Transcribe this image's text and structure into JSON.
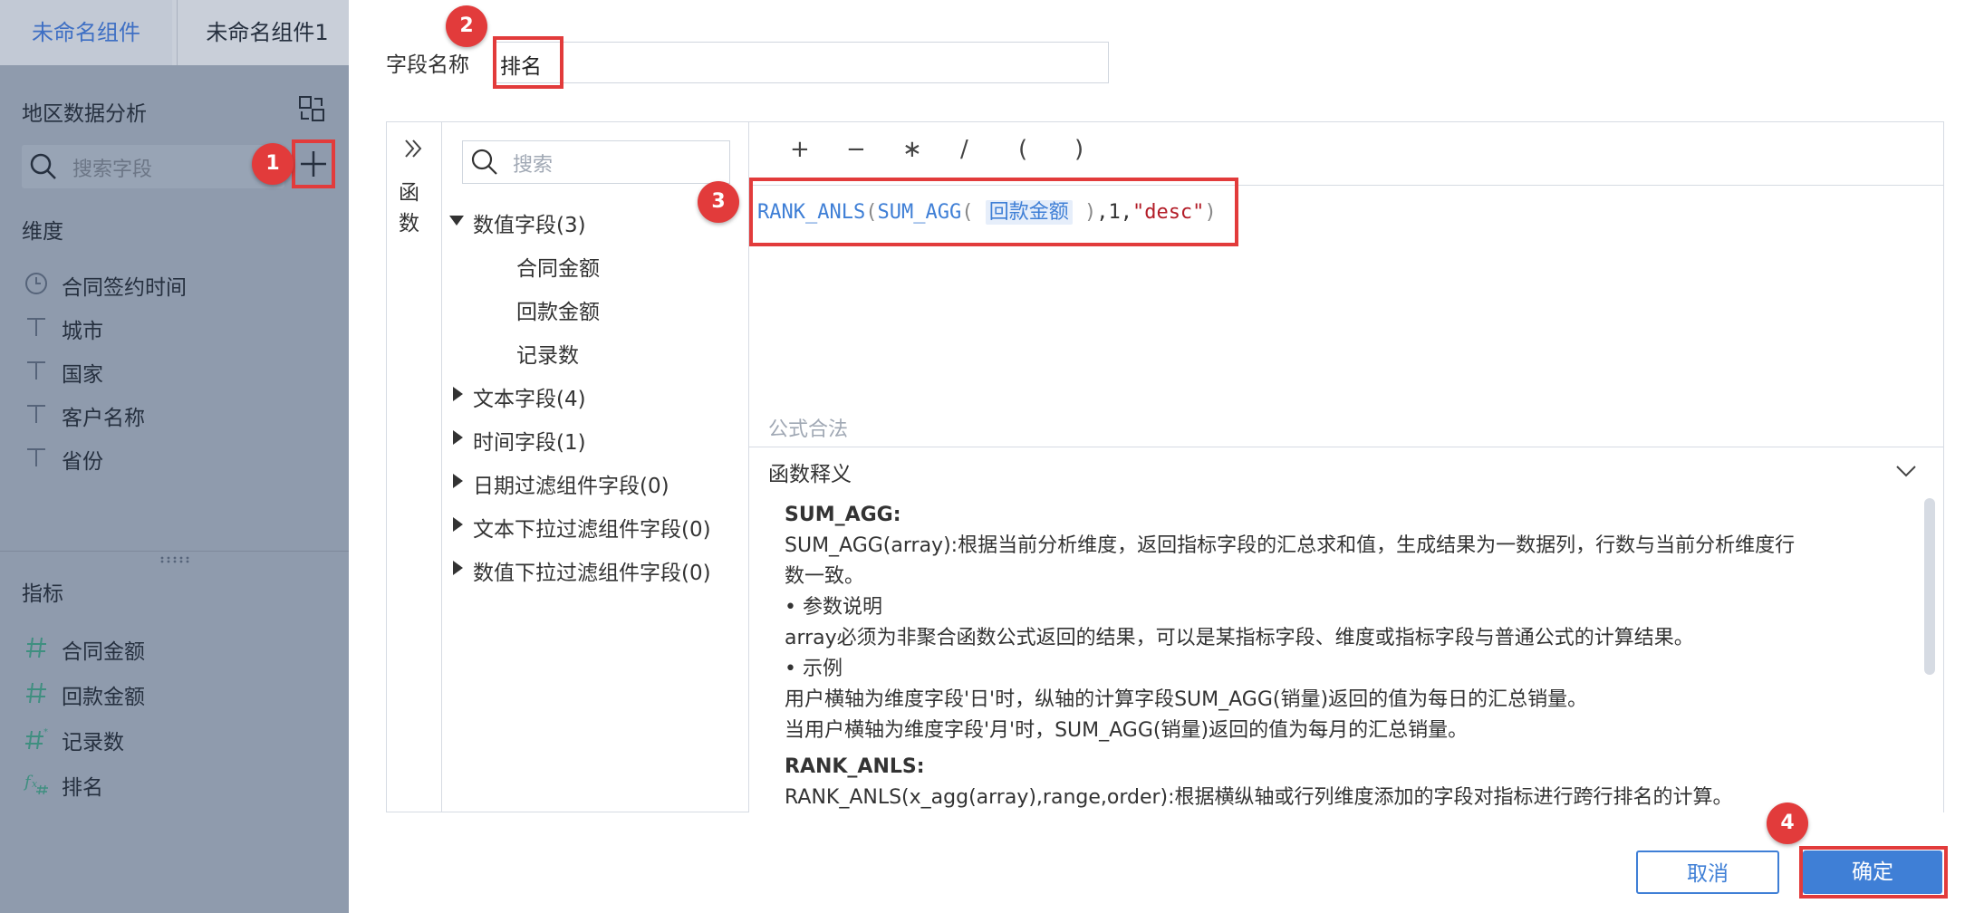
{
  "tabs": [
    "未命名组件",
    "未命名组件1"
  ],
  "left_panel": {
    "dataset_title": "地区数据分析",
    "search_placeholder": "搜索字段",
    "dimension_title": "维度",
    "dimensions": [
      {
        "label": "合同签约时间",
        "icon": "clock-icon"
      },
      {
        "label": "城市",
        "icon": "text-type-icon"
      },
      {
        "label": "国家",
        "icon": "text-type-icon"
      },
      {
        "label": "客户名称",
        "icon": "text-type-icon"
      },
      {
        "label": "省份",
        "icon": "text-type-icon"
      }
    ],
    "metric_title": "指标",
    "metrics": [
      {
        "label": "合同金额",
        "icon": "number-type-icon"
      },
      {
        "label": "回款金额",
        "icon": "number-type-icon"
      },
      {
        "label": "记录数",
        "icon": "count-type-icon"
      },
      {
        "label": "排名",
        "icon": "formula-type-icon"
      }
    ]
  },
  "badges": [
    "1",
    "2",
    "3",
    "4"
  ],
  "dialog": {
    "field_name_label": "字段名称",
    "field_name_value": "排名",
    "function_toggle_label": "函数",
    "field_search_placeholder": "搜索",
    "tree": [
      {
        "label": "数值字段(3)",
        "expanded": true,
        "children": [
          "合同金额",
          "回款金额",
          "记录数"
        ]
      },
      {
        "label": "文本字段(4)",
        "expanded": false
      },
      {
        "label": "时间字段(1)",
        "expanded": false
      },
      {
        "label": "日期过滤组件字段(0)",
        "expanded": false
      },
      {
        "label": "文本下拉过滤组件字段(0)",
        "expanded": false
      },
      {
        "label": "数值下拉过滤组件字段(0)",
        "expanded": false
      }
    ],
    "operators": [
      "+",
      "−",
      "∗",
      "/",
      "(",
      ")"
    ],
    "formula": {
      "fn1": "RANK_ANLS",
      "open1": "(",
      "fn2": "SUM_AGG",
      "open2": "(",
      "field": "回款金额",
      "close2": ")",
      "comma1": ",",
      "num": "1",
      "comma2": ",",
      "str": "\"desc\"",
      "close1": ")"
    },
    "validation_message": "公式合法",
    "explanation_title": "函数释义",
    "explanation": {
      "sum_title": "SUM_AGG:",
      "sum_desc1": "SUM_AGG(array):根据当前分析维度，返回指标字段的汇总求和值，生成结果为一数据列，行数与当前分析维度行",
      "sum_desc2": "数一致。",
      "param_title": "• 参数说明",
      "param_desc": "array必须为非聚合函数公式返回的结果，可以是某指标字段、维度或指标字段与普通公式的计算结果。",
      "example_title": "• 示例",
      "example1": "用户横轴为维度字段'日'时，纵轴的计算字段SUM_AGG(销量)返回的值为每日的汇总销量。",
      "example2": "当用户横轴为维度字段'月'时，SUM_AGG(销量)返回的值为每月的汇总销量。",
      "rank_title": "RANK_ANLS:",
      "rank_desc": "RANK_ANLS(x_agg(array),range,order):根据横纵轴或行列维度添加的字段对指标进行跨行排名的计算。"
    },
    "cancel_label": "取消",
    "ok_label": "确定"
  }
}
